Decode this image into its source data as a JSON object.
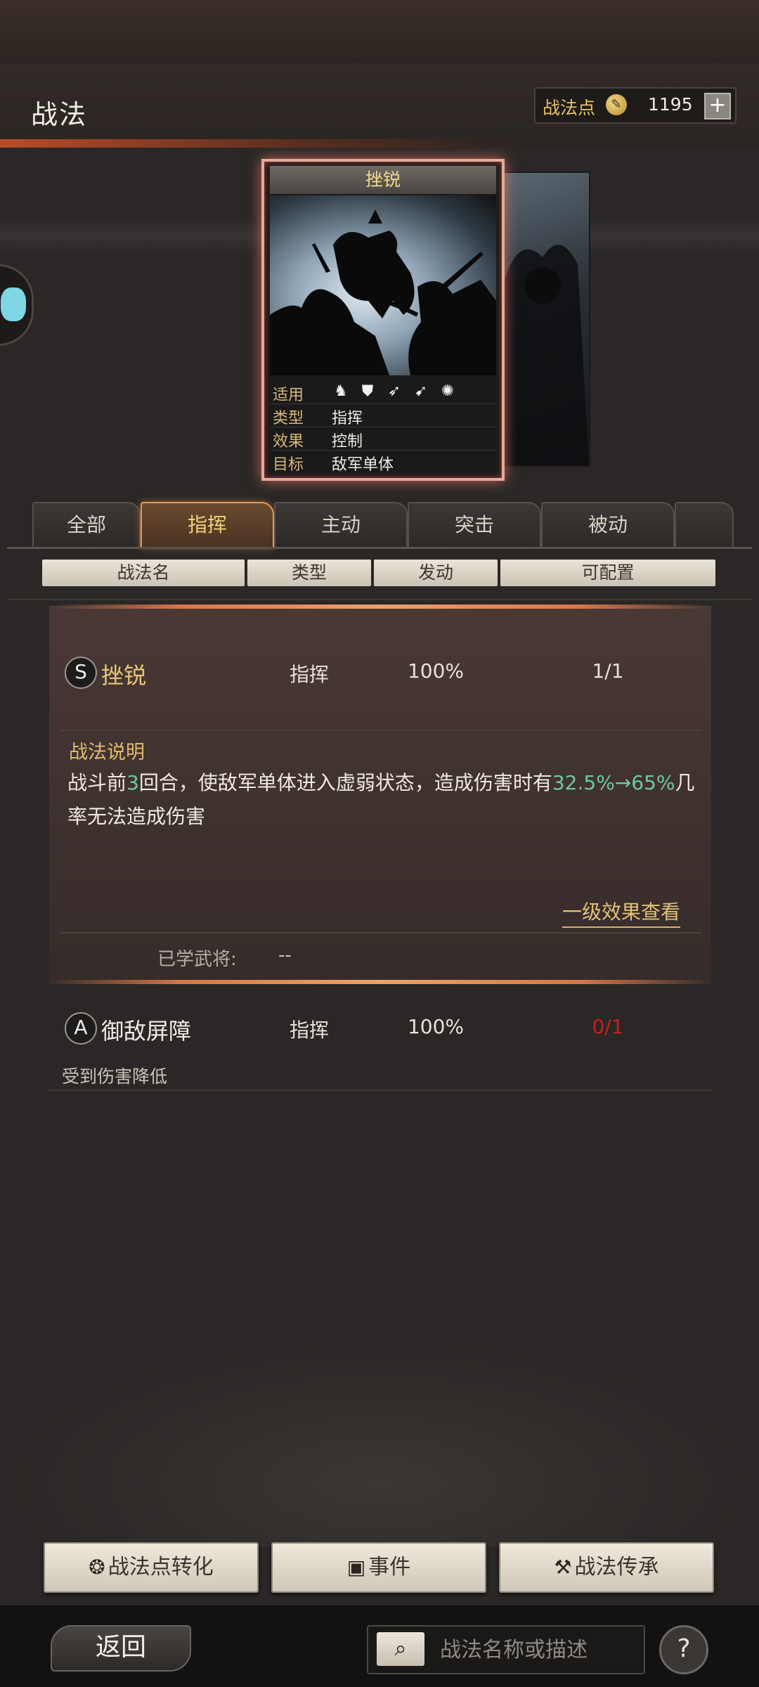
{
  "header": {
    "title": "战法",
    "points_label": "战法点",
    "points_value": "1195",
    "plus_label": "+"
  },
  "card": {
    "title": "挫锐",
    "rows": [
      {
        "key": "适用",
        "value": ""
      },
      {
        "key": "类型",
        "value": "指挥"
      },
      {
        "key": "效果",
        "value": "控制"
      },
      {
        "key": "目标",
        "value": "敌军单体"
      }
    ],
    "unit_icons": [
      "cavalry-icon",
      "shield-icon",
      "bow-icon",
      "spear-icon",
      "chariot-icon"
    ]
  },
  "tabs": [
    {
      "label": "全部",
      "active": false
    },
    {
      "label": "指挥",
      "active": true
    },
    {
      "label": "主动",
      "active": false
    },
    {
      "label": "突击",
      "active": false
    },
    {
      "label": "被动",
      "active": false
    }
  ],
  "columns": [
    "战法名",
    "类型",
    "发动",
    "可配置"
  ],
  "skills": [
    {
      "grade": "S",
      "name": "挫锐",
      "type": "指挥",
      "rate": "100%",
      "config": "1/1",
      "desc_title": "战法说明",
      "desc_parts": [
        "战斗前",
        "3",
        "回合，使敌军单体进入虚弱状态，造成伤害时有",
        "32.5%→65%",
        "几率无法造成伤害"
      ],
      "effect_link": "一级效果查看",
      "learned_label": "已学武将:",
      "learned_value": "--"
    },
    {
      "grade": "A",
      "name": "御敌屏障",
      "type": "指挥",
      "rate": "100%",
      "config": "0/1",
      "subtitle": "受到伤害降低"
    }
  ],
  "bottom_buttons": [
    {
      "label": "战法点转化",
      "icon": "coin-icon"
    },
    {
      "label": "事件",
      "icon": "event-icon"
    },
    {
      "label": "战法传承",
      "icon": "hammer-icon"
    }
  ],
  "footer": {
    "back_label": "返回",
    "search_placeholder": "战法名称或描述",
    "help_label": "?"
  },
  "colors": {
    "accent_gold": "#e4c17a",
    "highlight_green": "#6fc7a0",
    "config_red": "#c8201e",
    "skill_selected": "#e8c57a"
  }
}
